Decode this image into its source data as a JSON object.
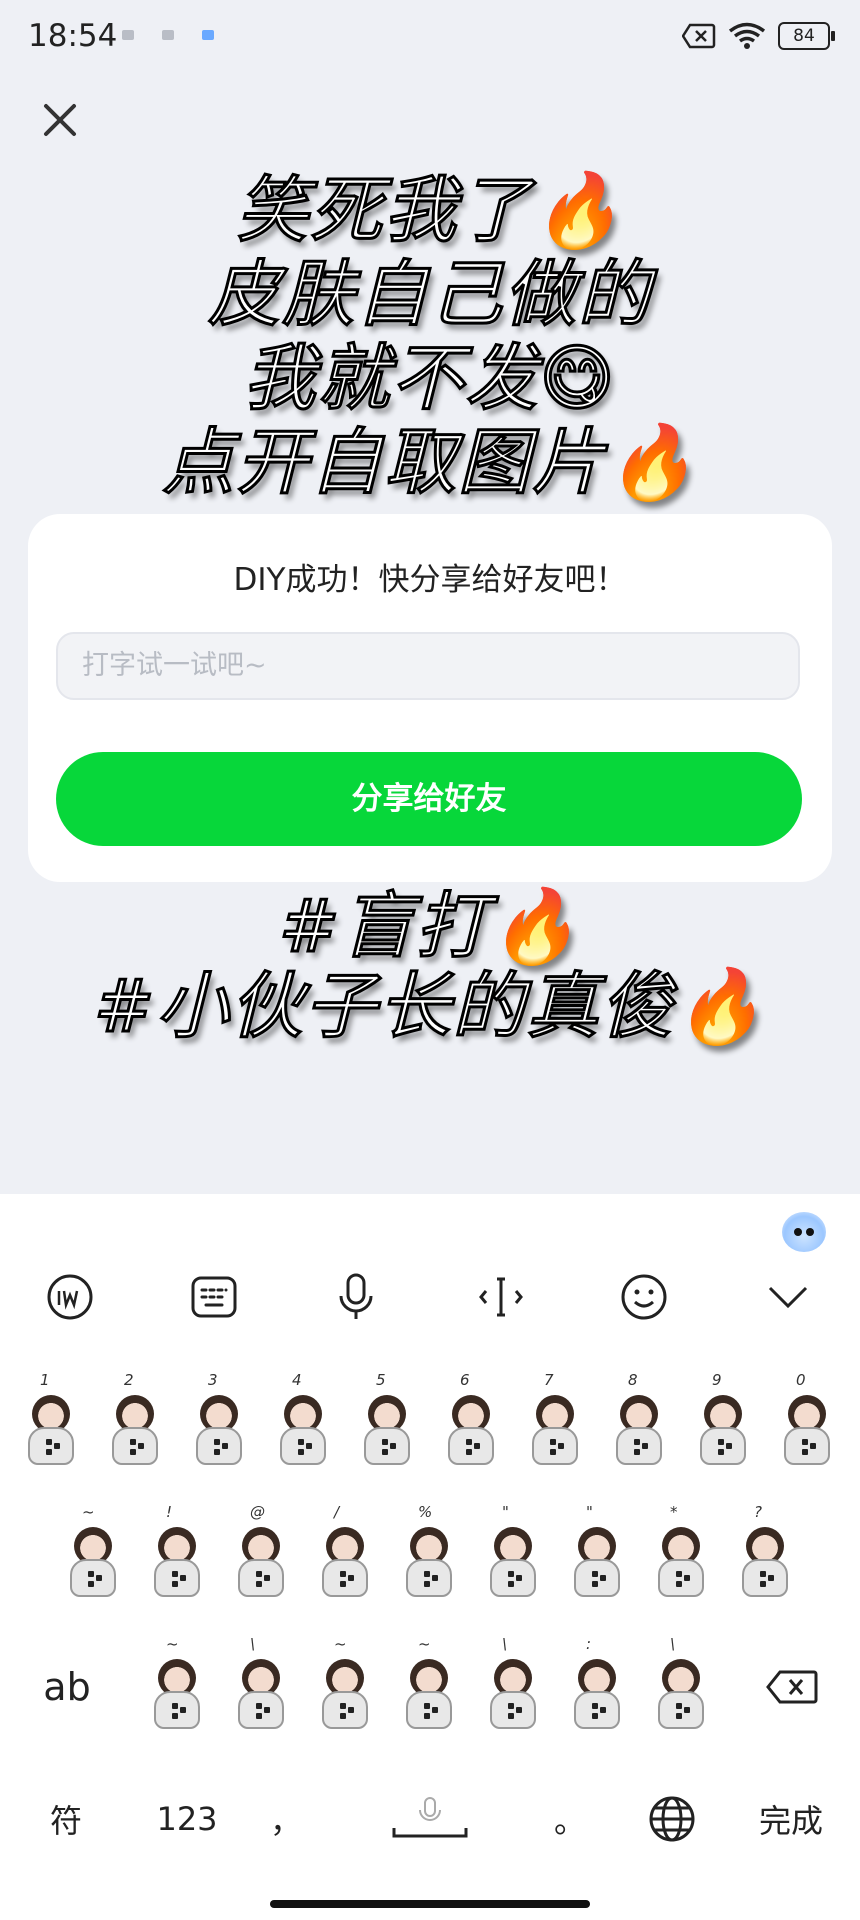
{
  "status_bar": {
    "time": "18:54",
    "battery": "84"
  },
  "overlay": {
    "lines": [
      "笑死我了🔥",
      "皮肤自己做的",
      "我就不发😋",
      "点开自取图片🔥"
    ]
  },
  "card": {
    "title": "DIY成功！快分享给好友吧！",
    "input_placeholder": "打字试一试吧~",
    "share_button": "分享给好友"
  },
  "hashtags": [
    "#盲打🔥",
    "#小伙子长的真俊🔥"
  ],
  "keyboard": {
    "toolbar": [
      "handwriting-icon",
      "keyboard-layout-icon",
      "microphone-icon",
      "cursor-icon",
      "emoji-icon",
      "collapse-icon"
    ],
    "row1": [
      "1",
      "2",
      "3",
      "4",
      "5",
      "6",
      "7",
      "8",
      "9",
      "0"
    ],
    "row2": [
      "~",
      "!",
      "@",
      "/",
      "%",
      "\"",
      "\"",
      "*",
      "?"
    ],
    "row3": [
      "~",
      "\\",
      "~",
      "~",
      "\\",
      ":",
      "\\"
    ],
    "mode_key": "ab",
    "bottom": {
      "symbols": "符",
      "numbers": "123",
      "comma": "，",
      "period": "。",
      "done": "完成"
    }
  },
  "colors": {
    "accent_green": "#07d73a",
    "background": "#eef0f5"
  }
}
